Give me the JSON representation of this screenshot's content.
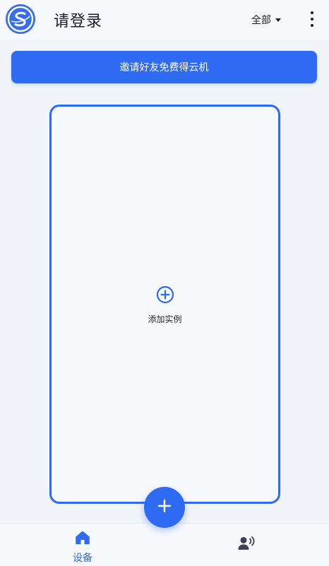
{
  "header": {
    "title": "请登录",
    "filter_label": "全部",
    "logo_icon": "app-logo-s-icon",
    "more_icon": "more-vertical-icon"
  },
  "invite": {
    "label": "邀请好友免费得云机"
  },
  "card": {
    "add_label": "添加实例",
    "add_icon": "plus-circle-icon"
  },
  "fab": {
    "icon": "plus-icon"
  },
  "bottom_nav": {
    "items": [
      {
        "label": "设备",
        "icon": "home-icon",
        "active": true
      },
      {
        "label": "",
        "icon": "voice-user-icon",
        "active": false
      }
    ]
  },
  "colors": {
    "accent": "#2f6bf2",
    "background": "#f1f4f9",
    "text": "#1b1f26"
  }
}
